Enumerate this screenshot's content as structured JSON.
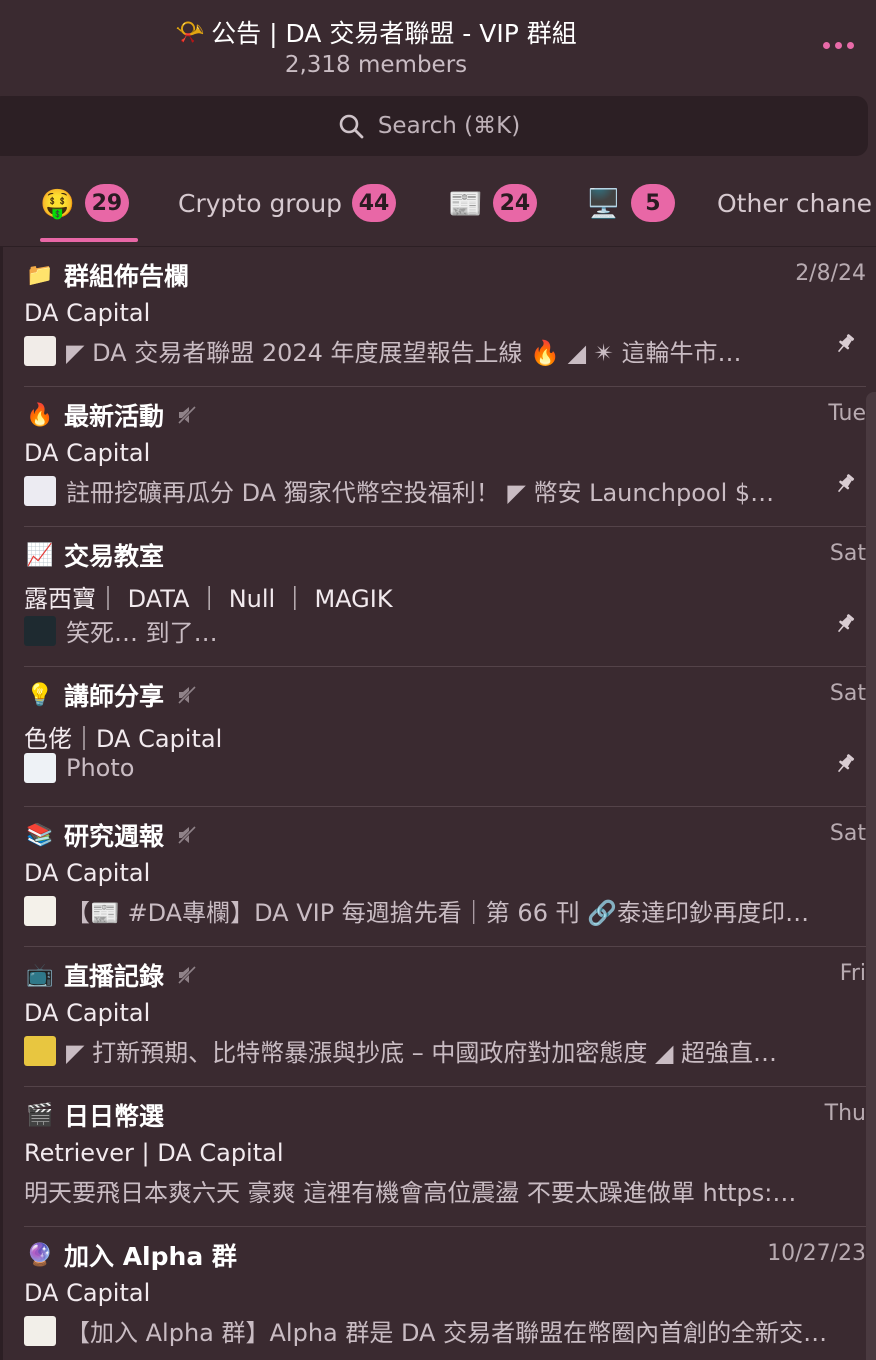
{
  "header": {
    "title_emoji": "📯",
    "title": "公告 | DA 交易者聯盟 - VIP 群組",
    "members": "2,318 members"
  },
  "search": {
    "label": "Search (⌘K)"
  },
  "tabs": [
    {
      "label": "🤑",
      "badge": "29",
      "active": true
    },
    {
      "label": "Crypto group",
      "badge": "44"
    },
    {
      "label": "📰",
      "badge": "24"
    },
    {
      "label": "🖥️",
      "badge": "5"
    },
    {
      "label": "Other chane"
    }
  ],
  "chats": [
    {
      "emoji": "📁",
      "title": "群組佈告欄",
      "muted": false,
      "date": "2/8/24",
      "sender": "DA Capital",
      "preview": "◤ DA 交易者聯盟 2024 年度展望報告上線 🔥 ◢ ✴︎ 這輪牛市…",
      "pinned": true
    },
    {
      "emoji": "🔥",
      "title": "最新活動",
      "muted": true,
      "date": "Tue",
      "sender": "DA Capital",
      "preview": "註冊挖礦再瓜分 DA 獨家代幣空投福利！ ◤ 幣安 Launchpool $…",
      "pinned": true
    },
    {
      "emoji": "📈",
      "title": "交易教室",
      "muted": false,
      "date": "Sat",
      "sender": "露西寶｜ DATA ｜ Null ｜ MAGIK",
      "preview": "笑死… 到了…",
      "pinned": true
    },
    {
      "emoji": "💡",
      "title": "講師分享",
      "muted": true,
      "date": "Sat",
      "sender": "色佬｜DA Capital",
      "preview": "Photo",
      "pinned": true
    },
    {
      "emoji": "📚",
      "title": "研究週報",
      "muted": true,
      "date": "Sat",
      "sender": "DA Capital",
      "preview": "【📰 #DA專欄】DA VIP 每週搶先看｜第 66 刊 🔗泰達印鈔再度印…",
      "pinned": false
    },
    {
      "emoji": "📺",
      "title": "直播記錄",
      "muted": true,
      "date": "Fri",
      "sender": "DA Capital",
      "preview": "◤ 打新預期、比特幣暴漲與抄底 – 中國政府對加密態度 ◢ 超強直…",
      "pinned": false
    },
    {
      "emoji": "🎬",
      "title": "日日幣選",
      "muted": false,
      "date": "Thu",
      "sender": "Retriever | DA Capital",
      "preview": "明天要飛日本爽六天 豪爽 這裡有機會高位震盪 不要太躁進做單  https:…",
      "pinned": false
    },
    {
      "emoji": "🔮",
      "title": "加入 Alpha 群",
      "muted": false,
      "date": "10/27/23",
      "sender": "DA Capital",
      "preview": "【加入 Alpha 群】Alpha 群是 DA 交易者聯盟在幣圈內首創的全新交…",
      "pinned": false
    }
  ],
  "colors": {
    "accent": "#e867a6",
    "background": "#3a2a30",
    "search_bg": "#2c1f24"
  }
}
